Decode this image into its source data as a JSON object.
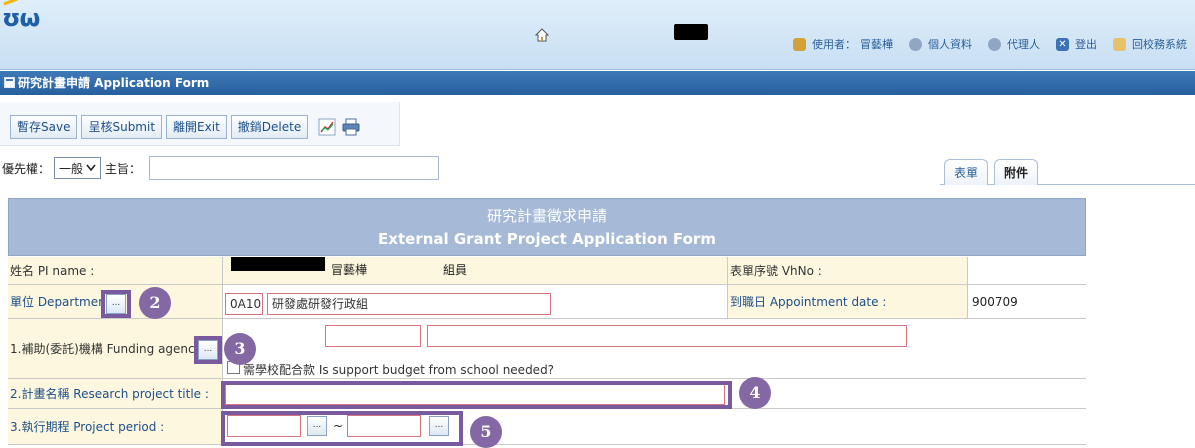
{
  "header": {
    "logo": "ʊω",
    "links": [
      {
        "label": "使用者：",
        "value": "冒藝樺"
      },
      {
        "label": "個人資料"
      },
      {
        "label": "代理人"
      },
      {
        "label": "登出"
      },
      {
        "label": "回校務系統"
      }
    ]
  },
  "window": {
    "title": "研究計畫申請 Application Form"
  },
  "toolbar": {
    "save": "暫存Save",
    "submit": "呈核Submit",
    "exit": "離開Exit",
    "delete": "撤銷Delete"
  },
  "priority": {
    "label": "優先權：",
    "selected": "一般",
    "subject_label": "主旨：",
    "subject_value": ""
  },
  "tabs": [
    "表單",
    "附件"
  ],
  "form": {
    "title_zh": "研究計畫徵求申請",
    "title_en": "External Grant Project Application Form",
    "pi_label": "姓名 PI name :",
    "pi_name": "冒藝樺",
    "pi_role": "組員",
    "vhno_label": "表單序號 VhNo :",
    "vhno_value": "",
    "dept_label": "單位 Department",
    "dept_code": "0A10",
    "dept_name": "研發處研發行政組",
    "appt_label": "到職日 Appointment date :",
    "appt_value": "900709",
    "funding_label": "1.補助(委託)機構 Funding agency :",
    "support_text": "需學校配合款 Is support budget from school needed?",
    "title_label": "2.計畫名稱 Research project title :",
    "period_label": "3.執行期程 Project period :",
    "period_sep": "~"
  },
  "annotations": [
    "2",
    "3",
    "4",
    "5"
  ],
  "colors": {
    "title_bar": "#2f6aa8",
    "form_header": "#a6b9d6",
    "label_bg": "#fdf7df",
    "badge": "#8468a3",
    "required_border": "#d9747f"
  }
}
